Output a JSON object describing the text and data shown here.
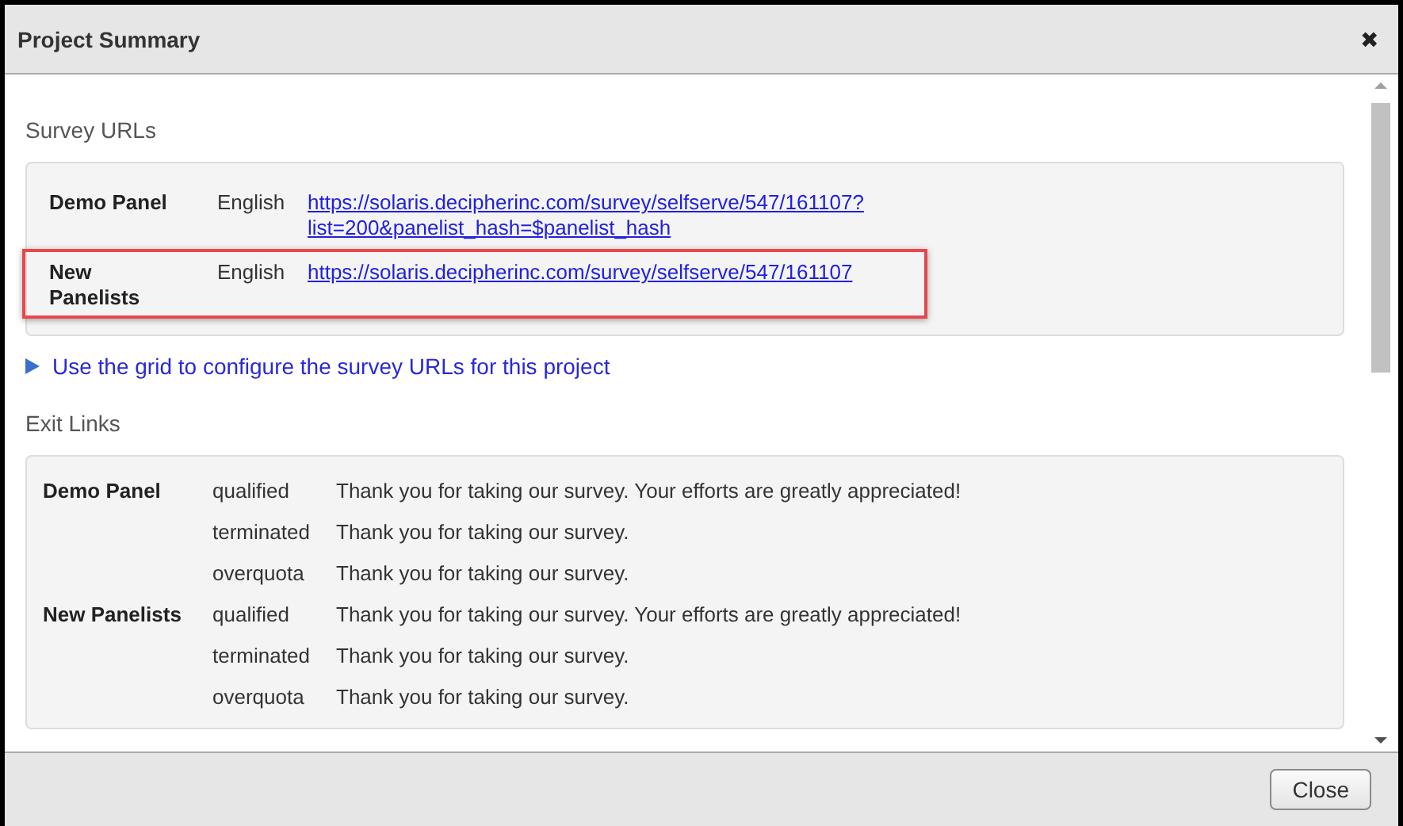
{
  "window": {
    "title": "Project Summary",
    "close_icon": "✖"
  },
  "survey_urls": {
    "heading": "Survey URLs",
    "rows": [
      {
        "panel": "Demo Panel",
        "language": "English",
        "url": "https://solaris.decipherinc.com/survey/selfserve/547/161107?list=200&panelist_hash=$panelist_hash",
        "highlighted": false
      },
      {
        "panel": "New Panelists",
        "language": "English",
        "url": "https://solaris.decipherinc.com/survey/selfserve/547/161107",
        "highlighted": true
      }
    ],
    "grid_link": "Use the grid to configure the survey URLs for this project"
  },
  "exit_links": {
    "heading": "Exit Links",
    "groups": [
      {
        "panel": "Demo Panel",
        "links": [
          {
            "type": "qualified",
            "message": "Thank you for taking our survey. Your efforts are greatly appreciated!"
          },
          {
            "type": "terminated",
            "message": "Thank you for taking our survey."
          },
          {
            "type": "overquota",
            "message": "Thank you for taking our survey."
          }
        ]
      },
      {
        "panel": "New Panelists",
        "links": [
          {
            "type": "qualified",
            "message": "Thank you for taking our survey. Your efforts are greatly appreciated!"
          },
          {
            "type": "terminated",
            "message": "Thank you for taking our survey."
          },
          {
            "type": "overquota",
            "message": "Thank you for taking our survey."
          }
        ]
      }
    ]
  },
  "buttons": [
    "Close"
  ]
}
